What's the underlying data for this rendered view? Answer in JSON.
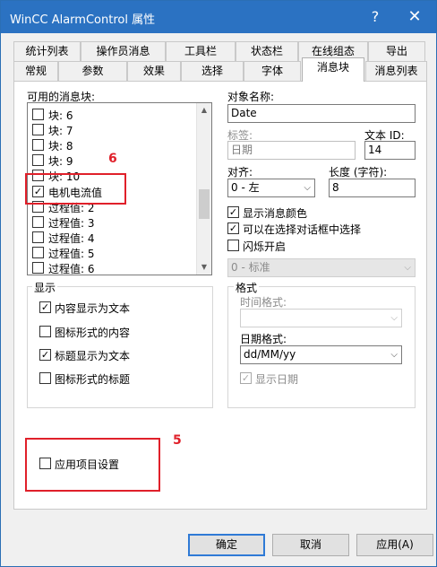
{
  "window": {
    "title": "WinCC AlarmControl 属性",
    "help_glyph": "?",
    "close_glyph": "✕"
  },
  "tabs_row1": [
    {
      "label": "统计列表"
    },
    {
      "label": "操作员消息"
    },
    {
      "label": "工具栏"
    },
    {
      "label": "状态栏"
    },
    {
      "label": "在线组态"
    },
    {
      "label": "导出"
    }
  ],
  "tabs_row2": [
    {
      "label": "常规"
    },
    {
      "label": "参数"
    },
    {
      "label": "效果"
    },
    {
      "label": "选择"
    },
    {
      "label": "字体"
    },
    {
      "label": "消息块",
      "active": true
    },
    {
      "label": "消息列表"
    }
  ],
  "available_blocks": {
    "label": "可用的消息块:",
    "items": [
      {
        "label": "块: 6",
        "checked": false
      },
      {
        "label": "块: 7",
        "checked": false
      },
      {
        "label": "块: 8",
        "checked": false
      },
      {
        "label": "块: 9",
        "checked": false
      },
      {
        "label": "块: 10",
        "checked": false
      },
      {
        "label": "电机电流值",
        "checked": true
      },
      {
        "label": "过程值: 2",
        "checked": false
      },
      {
        "label": "过程值: 3",
        "checked": false
      },
      {
        "label": "过程值: 4",
        "checked": false
      },
      {
        "label": "过程值: 5",
        "checked": false
      },
      {
        "label": "过程值: 6",
        "checked": false
      }
    ]
  },
  "object_name": {
    "label": "对象名称:",
    "value": "Date"
  },
  "tag": {
    "label": "标签:",
    "value": "日期"
  },
  "text_id": {
    "label": "文本 ID:",
    "value": "14"
  },
  "alignment": {
    "label": "对齐:",
    "value": "0 - 左"
  },
  "length": {
    "label": "长度 (字符):",
    "value": "8"
  },
  "options": {
    "show_message_color": {
      "label": "显示消息颜色",
      "checked": true
    },
    "select_in_dialog": {
      "label": "可以在选择对话框中选择",
      "checked": true
    },
    "flashing": {
      "label": "闪烁开启",
      "checked": false
    },
    "flash_mode": {
      "value": "0 - 标准"
    }
  },
  "display_group": {
    "title": "显示",
    "items": [
      {
        "label": "内容显示为文本",
        "checked": true
      },
      {
        "label": "图标形式的内容",
        "checked": false
      },
      {
        "label": "标题显示为文本",
        "checked": true
      },
      {
        "label": "图标形式的标题",
        "checked": false
      }
    ]
  },
  "format_group": {
    "title": "格式",
    "time_format_label": "时间格式:",
    "time_format_value": "",
    "date_format_label": "日期格式:",
    "date_format_value": "dd/MM/yy",
    "show_date": {
      "label": "显示日期",
      "checked": true
    }
  },
  "apply_project_settings": {
    "label": "应用项目设置",
    "checked": false
  },
  "annotations": {
    "mark_5": "5",
    "mark_6": "6"
  },
  "buttons": {
    "ok": "确定",
    "cancel": "取消",
    "apply": "应用(A)"
  },
  "icons": {
    "checkmark": "✓",
    "chevron_down": "⌵",
    "arrow_up": "▲",
    "arrow_down": "▼"
  },
  "colors": {
    "titlebar": "#2b72c2",
    "annotation_red": "#e0202a",
    "default_button_border": "#2f7ad6"
  }
}
